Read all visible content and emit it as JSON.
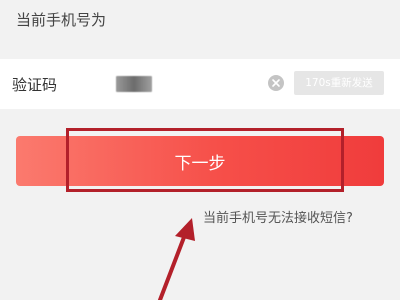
{
  "form": {
    "phone_label": "当前手机号为",
    "code_label": "验证码",
    "code_value": "",
    "resend_label": "170s重新发送",
    "next_label": "下一步",
    "cannot_receive_link": "当前手机号无法接收短信?"
  },
  "icons": {
    "clear": "clear-circle-icon"
  },
  "colors": {
    "button_gradient_start": "#fb7a6e",
    "button_gradient_end": "#f03c3c",
    "annotation": "#b3202a",
    "resend_disabled_bg": "#e6e6e6",
    "page_bg": "#f2f2f2"
  }
}
